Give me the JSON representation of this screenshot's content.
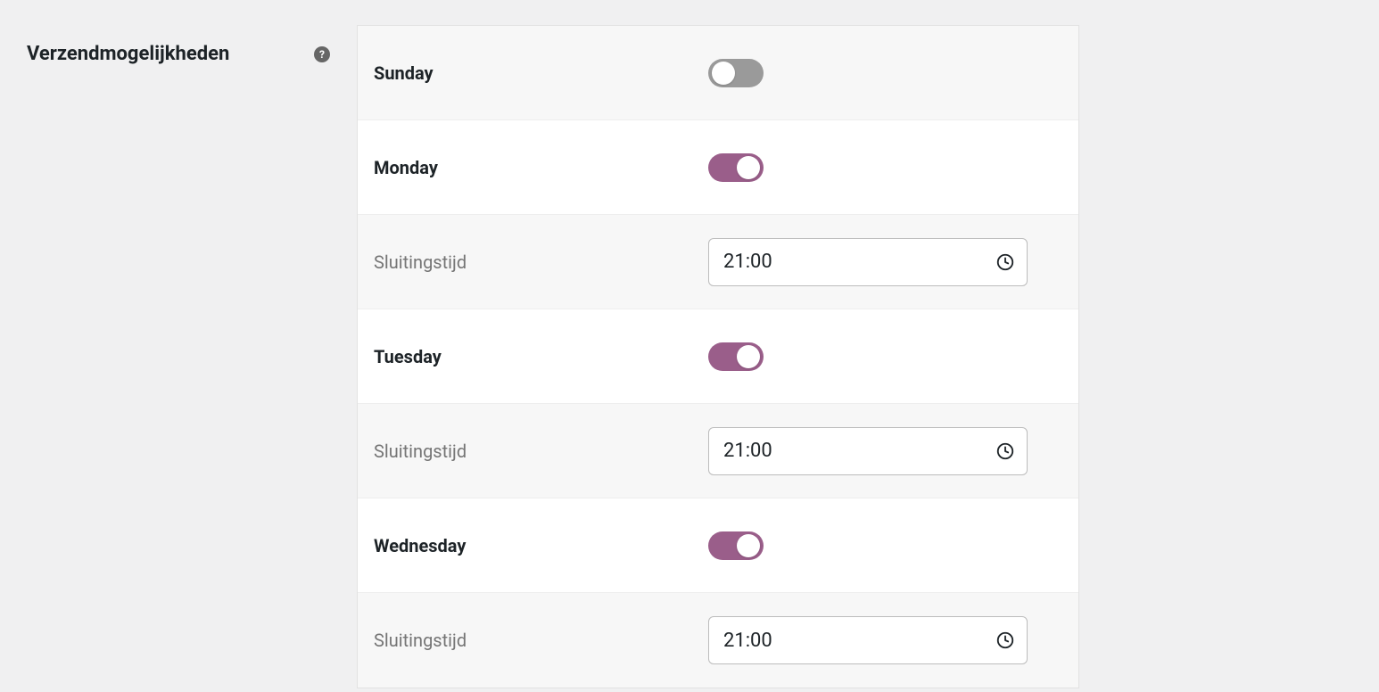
{
  "section": {
    "title": "Verzendmogelijkheden",
    "closing_label": "Sluitingstijd"
  },
  "days": [
    {
      "name": "Sunday",
      "enabled": false,
      "closing_time": ""
    },
    {
      "name": "Monday",
      "enabled": true,
      "closing_time": "21:00"
    },
    {
      "name": "Tuesday",
      "enabled": true,
      "closing_time": "21:00"
    },
    {
      "name": "Wednesday",
      "enabled": true,
      "closing_time": "21:00"
    }
  ],
  "colors": {
    "accent": "#9a5e8a",
    "toggle_off": "#9a9a9a"
  }
}
